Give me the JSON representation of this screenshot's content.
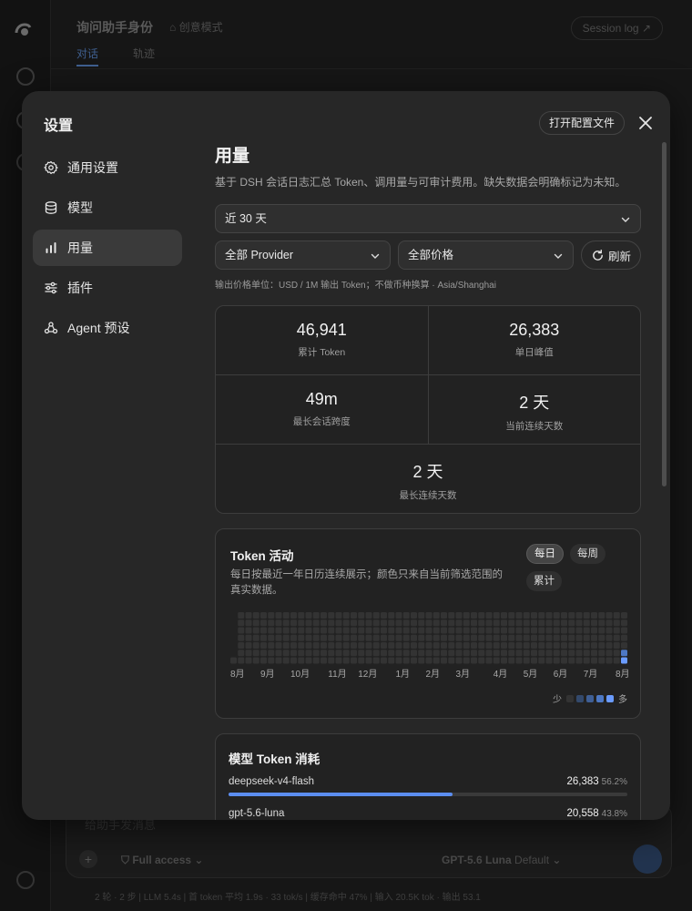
{
  "background": {
    "app_title": "询问助手身份",
    "mode_label": "创意模式",
    "tabs": [
      "对话",
      "轨迹"
    ],
    "session_log": "Session log",
    "composer_placeholder": "给助手发消息",
    "access_label": "Full access",
    "model_label": "GPT-5.6 Luna",
    "model_suffix": "Default",
    "status_line": "2 轮 · 2 步  |  LLM 5.4s  |  首 token 平均 1.9s · 33 tok/s  |  缓存命中 47%  |  输入 20.5K tok · 输出 53.1"
  },
  "modal": {
    "title": "设置",
    "open_config_label": "打开配置文件",
    "close_icon": "close-icon",
    "nav": [
      {
        "label": "通用设置",
        "icon": "gear-icon",
        "active": false
      },
      {
        "label": "模型",
        "icon": "database-icon",
        "active": false
      },
      {
        "label": "用量",
        "icon": "bar-chart-icon",
        "active": true
      },
      {
        "label": "插件",
        "icon": "sliders-icon",
        "active": false
      },
      {
        "label": "Agent 预设",
        "icon": "agent-icon",
        "active": false
      }
    ],
    "usage": {
      "title": "用量",
      "description": "基于 DSH 会话日志汇总 Token、调用量与可审计费用。缺失数据会明确标记为未知。",
      "range_select": "近 30 天",
      "provider_select": "全部 Provider",
      "price_select": "全部价格",
      "refresh_label": "刷新",
      "unit_note": "输出价格单位：USD / 1M 输出 Token；不做币种换算 · Asia/Shanghai",
      "stats": [
        {
          "value": "46,941",
          "label": "累计 Token"
        },
        {
          "value": "26,383",
          "label": "单日峰值"
        },
        {
          "value": "49m",
          "label": "最长会话跨度"
        },
        {
          "value": "2 天",
          "label": "当前连续天数"
        },
        {
          "value": "2 天",
          "label": "最长连续天数"
        }
      ],
      "activity": {
        "title": "Token 活动",
        "description": "每日按最近一年日历连续展示；颜色只来自当前筛选范围的真实数据。",
        "toggles": [
          "每日",
          "每周",
          "累计"
        ],
        "active_toggle": "每日",
        "months": [
          "8月",
          "9月",
          "10月",
          "11月",
          "12月",
          "1月",
          "2月",
          "3月",
          "4月",
          "5月",
          "6月",
          "7月",
          "8月"
        ],
        "legend_less": "少",
        "legend_more": "多",
        "legend_colors": [
          "#333333",
          "#33496c",
          "#3f5f95",
          "#4d78c4",
          "#6a9bff"
        ],
        "active_days": [
          {
            "day_index": 364,
            "level": 4
          },
          {
            "day_index": 363,
            "level": 3
          }
        ]
      },
      "models": {
        "title": "模型 Token 消耗",
        "items": [
          {
            "name": "deepseek-v4-flash",
            "tokens": "26,383",
            "pct": "56.2%",
            "share": 0.562
          },
          {
            "name": "gpt-5.6-luna",
            "tokens": "20,558",
            "pct": "43.8%",
            "share": 0.438
          }
        ]
      }
    }
  }
}
